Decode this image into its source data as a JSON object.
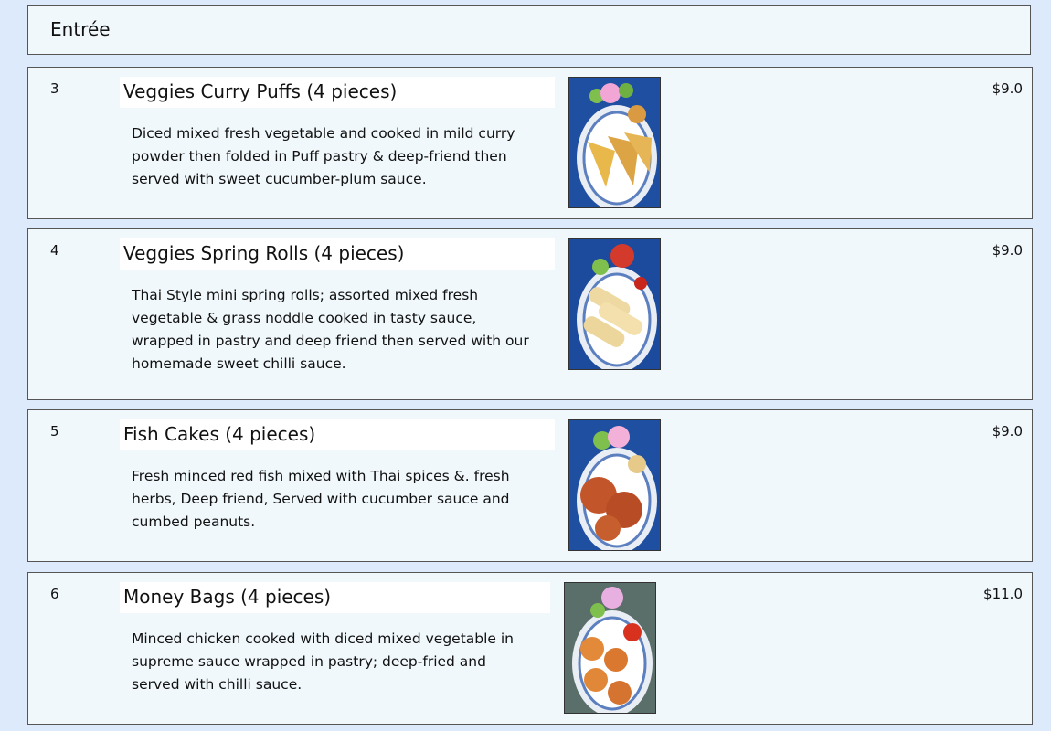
{
  "section": {
    "title": "Entrée"
  },
  "items": [
    {
      "number": "3",
      "title": "Veggies Curry Puffs (4 pieces)",
      "description": "Diced mixed fresh vegetable and cooked in mild curry powder then folded in Puff pastry & deep-friend then served with sweet cucumber-plum sauce.",
      "price": "$9.0"
    },
    {
      "number": "4",
      "title": "Veggies Spring Rolls (4 pieces)",
      "description": "Thai Style mini spring rolls; assorted mixed fresh vegetable & grass noddle cooked in tasty sauce, wrapped in pastry and deep friend then served with our homemade sweet chilli sauce.",
      "price": "$9.0"
    },
    {
      "number": "5",
      "title": "Fish Cakes (4 pieces)",
      "description": "Fresh minced red fish mixed with Thai spices &. fresh herbs, Deep friend, Served with cucumber sauce and cumbed peanuts.",
      "price": "$9.0"
    },
    {
      "number": "6",
      "title": "Money Bags (4 pieces)",
      "description": "Minced chicken cooked with diced mixed vegetable in supreme sauce wrapped in pastry; deep-fried and served with chilli sauce.",
      "price": "$11.0"
    }
  ]
}
